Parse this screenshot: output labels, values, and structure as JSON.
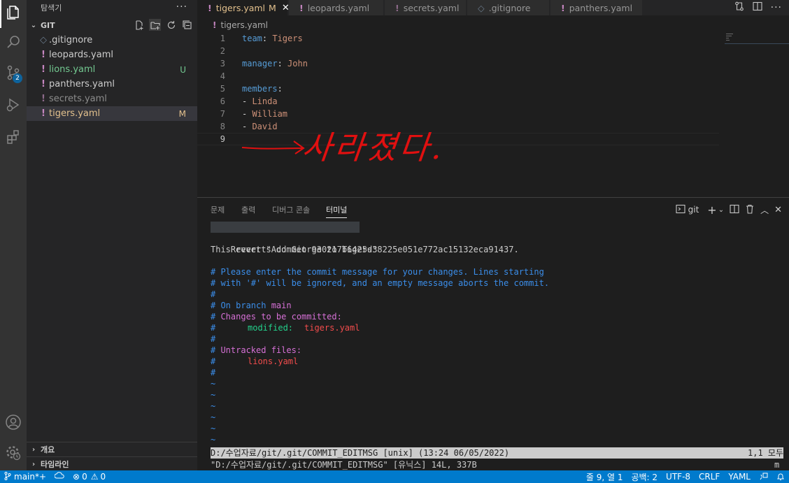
{
  "activity_bar": {
    "items": [
      {
        "icon": "files-icon",
        "active": true
      },
      {
        "icon": "search-icon"
      },
      {
        "icon": "source-control-icon",
        "badge": "2"
      },
      {
        "icon": "run-debug-icon"
      },
      {
        "icon": "extensions-icon"
      }
    ],
    "bottom": [
      {
        "icon": "account-icon"
      },
      {
        "icon": "settings-gear-icon"
      }
    ]
  },
  "sidebar": {
    "title": "탐색기",
    "more": "···",
    "section": "GIT",
    "files": [
      {
        "name": ".gitignore",
        "icon": "◇",
        "color": "#cccccc",
        "badge": ""
      },
      {
        "name": "leopards.yaml",
        "icon": "!",
        "color": "#cccccc",
        "badge": ""
      },
      {
        "name": "lions.yaml",
        "icon": "!",
        "color": "#73c991",
        "badge": "U"
      },
      {
        "name": "panthers.yaml",
        "icon": "!",
        "color": "#cccccc",
        "badge": ""
      },
      {
        "name": "secrets.yaml",
        "icon": "!",
        "color": "#8c8c8c",
        "badge": ""
      },
      {
        "name": "tigers.yaml",
        "icon": "!",
        "color": "#e2c08d",
        "badge": "M",
        "selected": true
      }
    ],
    "bottom_sections": [
      "개요",
      "타임라인"
    ]
  },
  "tabs": [
    {
      "label": "tigers.yaml",
      "badge": "M",
      "active": true,
      "icon": "!"
    },
    {
      "label": "leopards.yaml",
      "icon": "!"
    },
    {
      "label": "secrets.yaml",
      "icon": "!"
    },
    {
      "label": ".gitignore",
      "icon": "◇"
    },
    {
      "label": "panthers.yaml",
      "icon": "!"
    }
  ],
  "breadcrumb": {
    "icon": "!",
    "file": "tigers.yaml"
  },
  "editor": {
    "lines": [
      {
        "n": "1",
        "key": "team",
        "sep": ": ",
        "val": "Tigers"
      },
      {
        "n": "2",
        "key": "",
        "sep": "",
        "val": ""
      },
      {
        "n": "3",
        "key": "manager",
        "sep": ": ",
        "val": "John"
      },
      {
        "n": "4",
        "key": "",
        "sep": "",
        "val": ""
      },
      {
        "n": "5",
        "key": "members",
        "sep": ":",
        "val": ""
      },
      {
        "n": "6",
        "key": "",
        "sep": "- ",
        "val": "Linda"
      },
      {
        "n": "7",
        "key": "",
        "sep": "- ",
        "val": "William"
      },
      {
        "n": "8",
        "key": "",
        "sep": "- ",
        "val": "David"
      },
      {
        "n": "9",
        "key": "",
        "sep": "",
        "val": ""
      }
    ],
    "annotation_text": "사라졌다."
  },
  "panel": {
    "tabs": [
      "문제",
      "출력",
      "디버그 콘솔",
      "터미널"
    ],
    "active_tab": "터미널",
    "terminal_name": "git"
  },
  "terminal": {
    "first_line": "Revert \"Add George to Tigers\"",
    "revert_line": "This reverts commit 930217b6425d38225e051e772ac15132eca91437.",
    "c1": "# Please enter the commit message for your changes. Lines starting",
    "c2": "# with '#' will be ignored, and an empty message aborts the commit.",
    "c3": "#",
    "c4_hash": "# ",
    "c4_text": "On branch ",
    "c4_branch": "main",
    "c5_hash": "# ",
    "c5_text": "Changes to be committed:",
    "c6_hash": "#",
    "c6_mod": "modified:",
    "c6_file": "tigers.yaml",
    "c7": "#",
    "c8_hash": "# ",
    "c8_text": "Untracked files:",
    "c9_hash": "#",
    "c9_file": "lions.yaml",
    "c10": "#",
    "tilde": "~",
    "vim_status_left": "D:/수업자료/git/.git/COMMIT_EDITMSG [unix] (13:24 06/05/2022)",
    "vim_status_right": "1,1 모두",
    "vim_msg": "\"D:/수업자료/git/.git/COMMIT_EDITMSG\" [유닉스] 14L, 337B",
    "vim_mode": "m"
  },
  "status_bar": {
    "branch": "main*+",
    "errors": "0",
    "warnings": "0",
    "position": "줄 9, 열 1",
    "spaces": "공백: 2",
    "encoding": "UTF-8",
    "eol": "CRLF",
    "language": "YAML"
  },
  "colors": {
    "accent": "#007acc",
    "modified": "#e2c08d",
    "untracked": "#73c991",
    "yaml_icon": "#c586c0"
  }
}
